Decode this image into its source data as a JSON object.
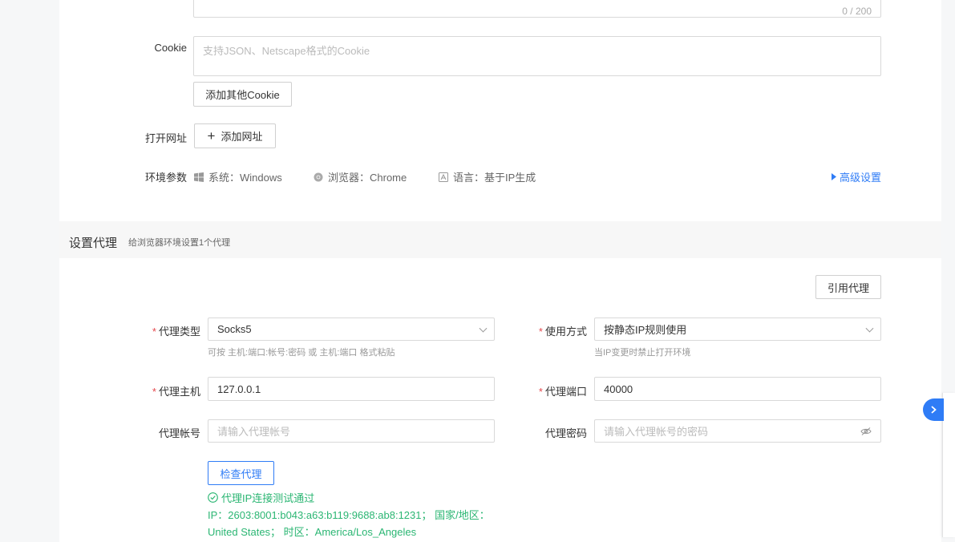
{
  "textarea_top": {
    "counter": "0 / 200"
  },
  "cookie": {
    "label": "Cookie",
    "placeholder": "支持JSON、Netscape格式的Cookie",
    "add_button": "添加其他Cookie"
  },
  "open_url": {
    "label": "打开网址",
    "add_button": "添加网址",
    "plus": "+"
  },
  "env": {
    "label": "环境参数",
    "system": "系统：Windows",
    "browser": "浏览器：Chrome",
    "language": "语言：基于IP生成",
    "advanced": "高级设置"
  },
  "proxy_section": {
    "title": "设置代理",
    "subtitle": "给浏览器环境设置1个代理",
    "cite_button": "引用代理"
  },
  "proxy_form": {
    "required_mark": "*",
    "type_label": "代理类型",
    "type_value": "Socks5",
    "type_hint": "可按 主机:端口:帐号:密码 或 主机:端口 格式粘贴",
    "usage_label": "使用方式",
    "usage_value": "按静态IP规则使用",
    "usage_hint": "当IP变更时禁止打开环境",
    "host_label": "代理主机",
    "host_value": "127.0.0.1",
    "port_label": "代理端口",
    "port_value": "40000",
    "account_label": "代理帐号",
    "account_placeholder": "请输入代理帐号",
    "password_label": "代理密码",
    "password_placeholder": "请输入代理帐号的密码",
    "check_button": "检查代理"
  },
  "proxy_result": {
    "status": "代理IP连接测试通过",
    "ip_line": "IP：2603:8001:b043:a63:b119:9688:ab8:1231；  国家/地区：",
    "location_line": "United States；  时区：America/Los_Angeles"
  },
  "colors": {
    "accent": "#2f7cf6",
    "success": "#2bb673",
    "required": "#e5484d"
  },
  "icons": {
    "windows": "windows-icon",
    "chrome": "chrome-icon",
    "language": "language-icon",
    "advanced": "caret-right-icon",
    "eye": "eye-hidden-icon",
    "check": "check-circle-icon",
    "float": "chevron-right-icon"
  }
}
